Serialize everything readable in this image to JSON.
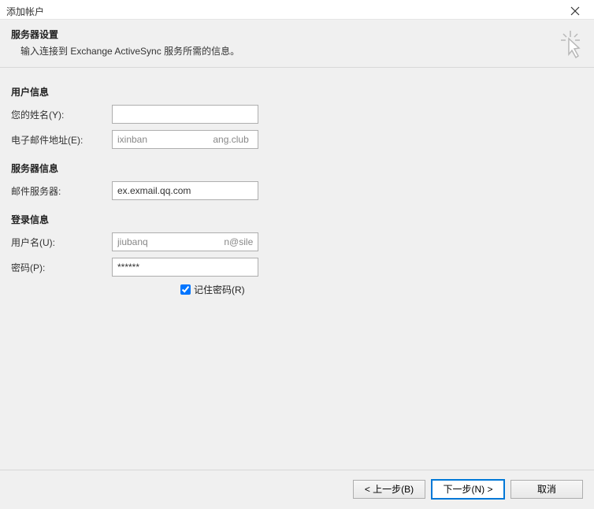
{
  "window": {
    "title": "添加帐户"
  },
  "header": {
    "title": "服务器设置",
    "subtitle": "输入连接到 Exchange ActiveSync 服务所需的信息。"
  },
  "sections": {
    "user_info": "用户信息",
    "server_info": "服务器信息",
    "login_info": "登录信息"
  },
  "fields": {
    "name": {
      "label": "您的姓名(Y):",
      "value": ""
    },
    "email": {
      "label": "电子邮件地址(E):",
      "value": "ixinban                         ang.club"
    },
    "mail_server": {
      "label": "邮件服务器:",
      "value": "ex.exmail.qq.com"
    },
    "username": {
      "label": "用户名(U):",
      "value": "jiubanq                             n@silenc"
    },
    "password": {
      "label": "密码(P):",
      "value": "******"
    }
  },
  "remember": {
    "label": "记住密码(R)",
    "checked": true
  },
  "buttons": {
    "back": "< 上一步(B)",
    "next": "下一步(N) >",
    "cancel": "取消"
  }
}
